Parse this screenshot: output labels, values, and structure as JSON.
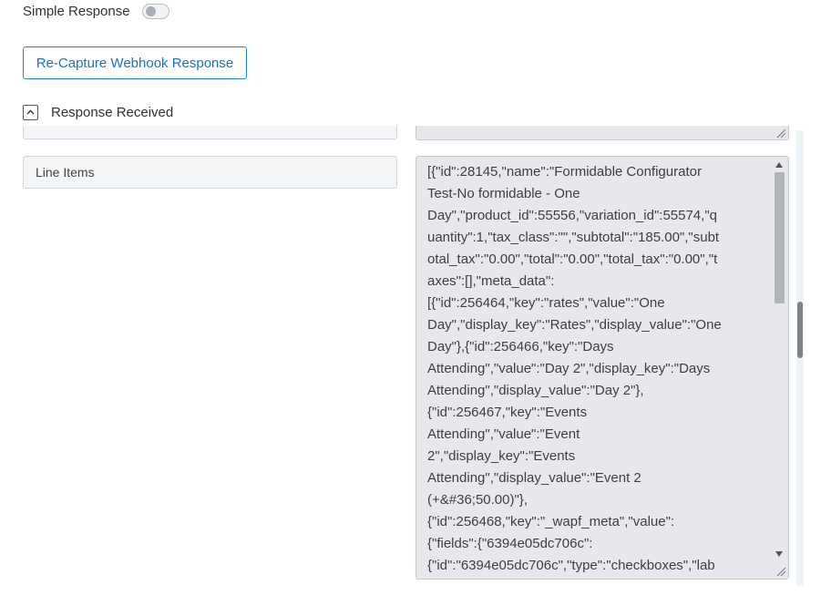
{
  "simple_response": {
    "label": "Simple Response",
    "enabled": false
  },
  "recapture_button": {
    "label": "Re-Capture Webhook Response"
  },
  "response_section": {
    "label": "Response Received",
    "expanded": true
  },
  "fields": [
    {
      "key": "Line Items",
      "value_lines": [
        "[{\"id\":28145,\"name\":\"Formidable Configurator",
        "Test-No formidable - One",
        "Day\",\"product_id\":55556,\"variation_id\":55574,\"q",
        "uantity\":1,\"tax_class\":\"\",\"subtotal\":\"185.00\",\"subt",
        "otal_tax\":\"0.00\",\"total\":\"0.00\",\"total_tax\":\"0.00\",\"t",
        "axes\":[],\"meta_data\":",
        "[{\"id\":256464,\"key\":\"rates\",\"value\":\"One",
        "Day\",\"display_key\":\"Rates\",\"display_value\":\"One",
        "Day\"},{\"id\":256466,\"key\":\"Days",
        "Attending\",\"value\":\"Day 2\",\"display_key\":\"Days",
        "Attending\",\"display_value\":\"Day 2\"},",
        "{\"id\":256467,\"key\":\"Events",
        "Attending\",\"value\":\"Event",
        "2\",\"display_key\":\"Events",
        "Attending\",\"display_value\":\"Event 2",
        "(+&#36;50.00)\"},",
        "{\"id\":256468,\"key\":\"_wapf_meta\",\"value\":",
        "{\"fields\":{\"6394e05dc706c\":",
        "{\"id\":\"6394e05dc706c\",\"type\":\"checkboxes\",\"lab"
      ]
    }
  ],
  "colors": {
    "accent": "#1d72c1",
    "field_bg": "#f3f5f7",
    "textarea_bg": "#e6e8eb"
  },
  "icons": {
    "collapse": "chevron-up-icon",
    "resize": "resize-grip-icon"
  }
}
